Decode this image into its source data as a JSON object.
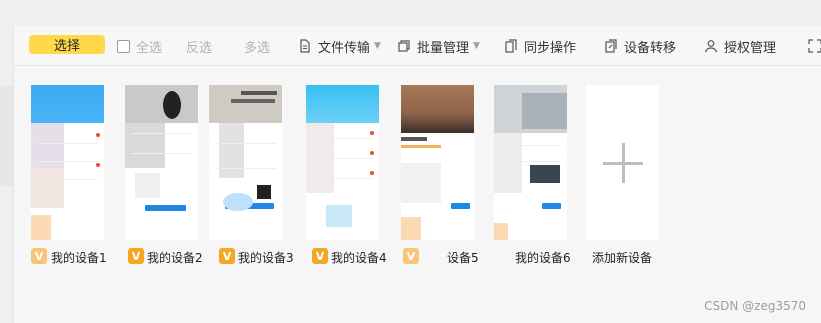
{
  "toolbar": {
    "select_label": "选择",
    "select_all_label": "全选",
    "invert_label": "反选",
    "multi_label": "多选",
    "file_transfer_label": "文件传输",
    "batch_manage_label": "批量管理",
    "sync_label": "同步操作",
    "transfer_label": "设备转移",
    "auth_label": "授权管理"
  },
  "devices": [
    {
      "name": "我的设备1",
      "badge": "V"
    },
    {
      "name": "我的设备2",
      "badge": "V"
    },
    {
      "name": "我的设备3",
      "badge": "V"
    },
    {
      "name": "我的设备4",
      "badge": "V"
    },
    {
      "name": "设备5",
      "badge": "V"
    },
    {
      "name": "我的设备6",
      "badge": "V"
    }
  ],
  "add_device_label": "添加新设备",
  "watermark": "CSDN @zeg3570",
  "colors": {
    "accent": "#ffd94a",
    "badge": "#f5a623",
    "blue": "#1e88e5"
  }
}
